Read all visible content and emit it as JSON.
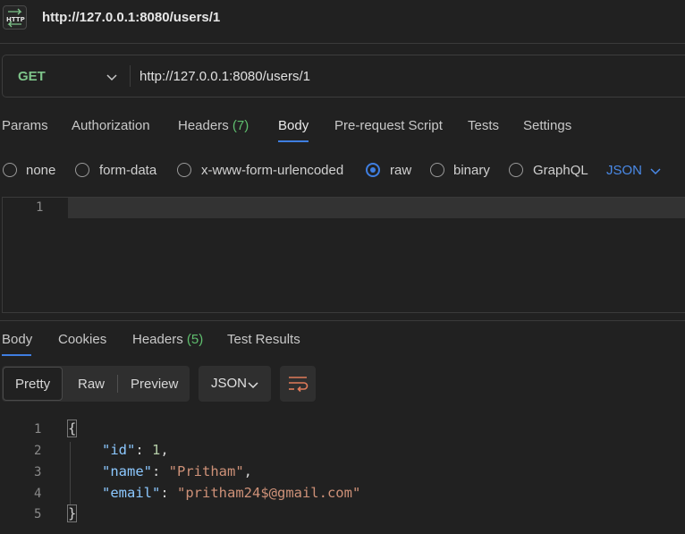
{
  "header": {
    "title": "http://127.0.0.1:8080/users/1"
  },
  "request": {
    "method": "GET",
    "url": "http://127.0.0.1:8080/users/1",
    "tabs": [
      {
        "label": "Params"
      },
      {
        "label": "Authorization"
      },
      {
        "label": "Headers",
        "count": "(7)"
      },
      {
        "label": "Body",
        "active": true
      },
      {
        "label": "Pre-request Script"
      },
      {
        "label": "Tests"
      },
      {
        "label": "Settings"
      }
    ],
    "body_modes": [
      {
        "label": "none"
      },
      {
        "label": "form-data"
      },
      {
        "label": "x-www-form-urlencoded"
      },
      {
        "label": "raw",
        "selected": true
      },
      {
        "label": "binary"
      },
      {
        "label": "GraphQL"
      }
    ],
    "raw_format": "JSON",
    "editor": {
      "line_numbers": [
        "1"
      ]
    }
  },
  "response": {
    "tabs": [
      {
        "label": "Body",
        "active": true
      },
      {
        "label": "Cookies"
      },
      {
        "label": "Headers",
        "count": "(5)"
      },
      {
        "label": "Test Results"
      }
    ],
    "views": [
      "Pretty",
      "Raw",
      "Preview"
    ],
    "active_view": "Pretty",
    "format": "JSON",
    "line_numbers": [
      "1",
      "2",
      "3",
      "4",
      "5"
    ],
    "lines": {
      "l1": "{",
      "id_key": "\"id\"",
      "id_val": "1",
      "name_key": "\"name\"",
      "name_val": "\"Pritham\"",
      "email_key": "\"email\"",
      "email_val": "\"pritham24$@gmail.com\"",
      "l5": "}",
      "colon": ": ",
      "comma": ","
    }
  },
  "colors": {
    "accent": "#3f7ee0",
    "method": "#7ec48a",
    "count": "#5fbf6e"
  }
}
